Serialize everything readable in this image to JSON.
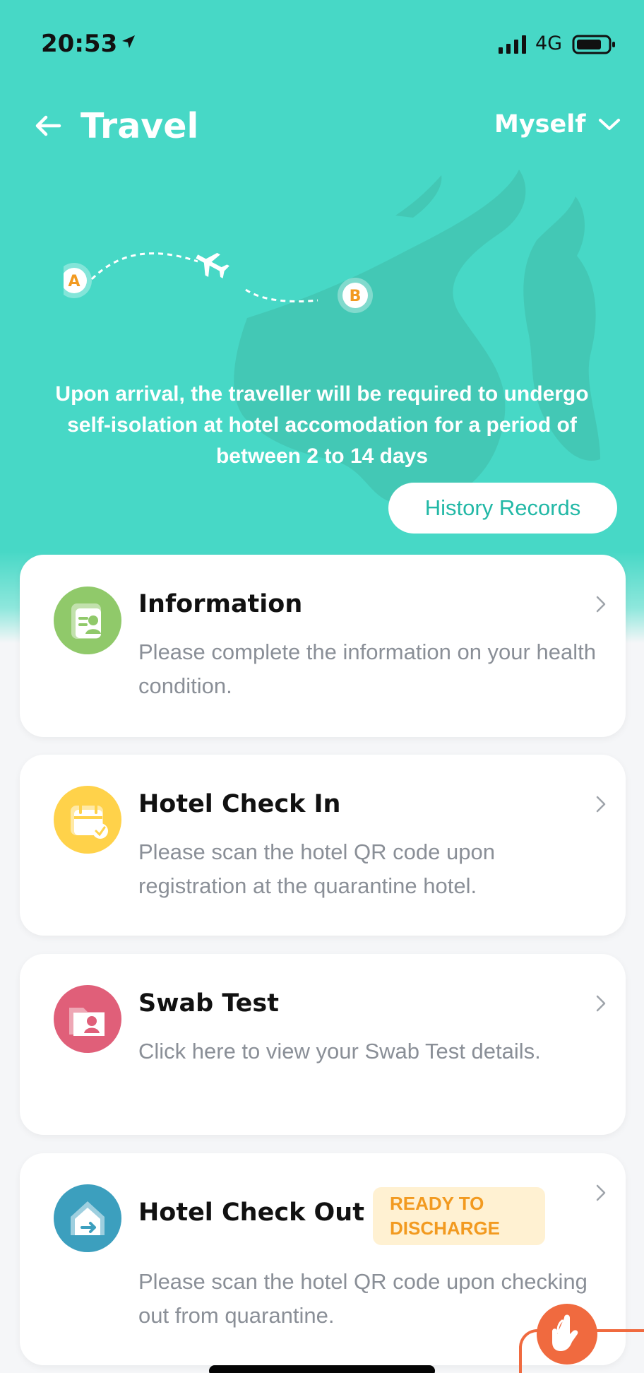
{
  "status_bar": {
    "time": "20:53",
    "network": "4G"
  },
  "header": {
    "title": "Travel",
    "profile": "Myself"
  },
  "route_labels": {
    "start": "A",
    "end": "B"
  },
  "notice": "Upon arrival, the traveller will be required to undergo self-isolation at hotel accomodation for a period of between 2 to 14 days",
  "history_button": "History Records",
  "cards": [
    {
      "title": "Information",
      "description": "Please complete the information on your health condition."
    },
    {
      "title": "Hotel Check In",
      "description": "Please scan the hotel QR code upon registration at the quarantine hotel."
    },
    {
      "title": "Swab Test",
      "description": "Click here to view your Swab Test details."
    },
    {
      "title": "Hotel Check Out",
      "badge": "READY TO DISCHARGE",
      "description": "Please scan the hotel QR code upon checking out from quarantine."
    }
  ],
  "colors": {
    "header_bg": "#47d8c6",
    "accent": "#22b8a6",
    "information_icon": "#90c96a",
    "check_in_icon": "#ffd24a",
    "swab_icon": "#e05f79",
    "check_out_icon": "#3c9fbe",
    "badge_text": "#f29a20",
    "helper_button": "#f06a3f"
  },
  "icons": {
    "back": "arrow-left-icon",
    "profile": "chevron-down-icon",
    "card_chevron": "chevron-right-icon",
    "helper": "hand-pointer-icon"
  }
}
